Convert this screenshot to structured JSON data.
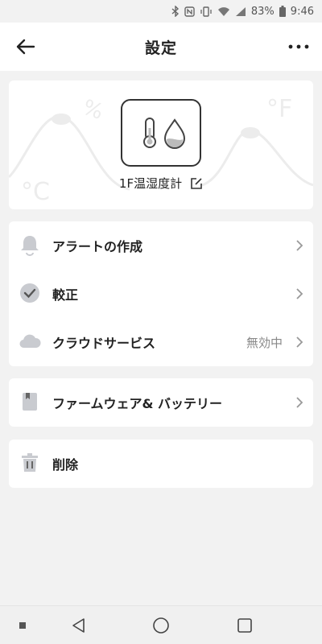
{
  "status": {
    "battery": "83%",
    "time": "9:46"
  },
  "header": {
    "title": "設定"
  },
  "device": {
    "name": "1F温湿度計"
  },
  "menu": {
    "alert": {
      "label": "アラートの作成"
    },
    "calibration": {
      "label": "較正"
    },
    "cloud": {
      "label": "クラウドサービス",
      "value": "無効中"
    },
    "firmware": {
      "label": "ファームウェア& バッテリー"
    },
    "delete": {
      "label": "削除"
    }
  },
  "colors": {
    "background": "#f2f2f2",
    "card": "#ffffff",
    "icon": "#c9cbd0",
    "text": "#222222"
  }
}
